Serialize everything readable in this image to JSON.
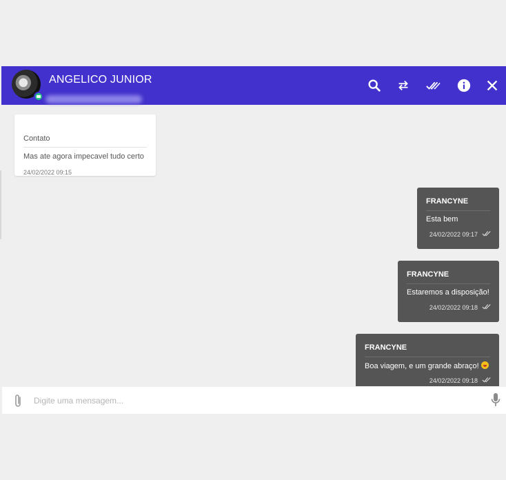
{
  "header": {
    "contact_name": "ANGELICO JUNIOR",
    "accent_color": "#4231cc",
    "icons": [
      "search-icon",
      "transfer-icon",
      "double-check-icon",
      "info-icon",
      "close-icon"
    ]
  },
  "messages": {
    "incoming": {
      "author": "Contato",
      "text": "Mas ate agora impecavel tudo certo",
      "time": "24/02/2022 09:15"
    },
    "outgoing": [
      {
        "author": "FRANCYNE",
        "text": "Esta bem",
        "time": "24/02/2022 09:17"
      },
      {
        "author": "FRANCYNE",
        "text": "Estaremos a disposição!",
        "time": "24/02/2022 09:18"
      },
      {
        "author": "FRANCYNE",
        "text": "Boa viagem, e um grande abraço!",
        "emoji": "smiling-face-emoji",
        "time": "24/02/2022 09:18"
      }
    ],
    "outgoing_bubble_color": "#555555"
  },
  "composer": {
    "placeholder": "Digite uma mensagem...",
    "value": ""
  }
}
